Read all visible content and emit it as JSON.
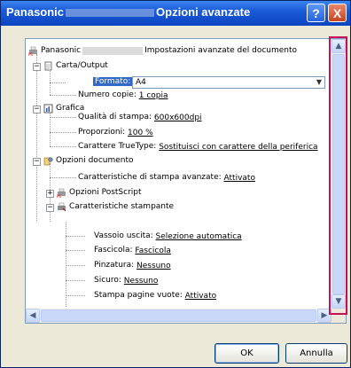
{
  "window": {
    "title_prefix": "Panasonic",
    "title_suffix": "Opzioni avanzate",
    "help_label": "?",
    "close_label": "X"
  },
  "tree": {
    "root_prefix": "Panasonic",
    "root_suffix": "Impostazioni avanzate del documento",
    "carta_output": "Carta/Output",
    "formato_label": "Formato:",
    "formato_value": "A4",
    "numero_copie_label": "Numero copie:",
    "numero_copie_value": "1 copia",
    "grafica": "Grafica",
    "qualita_label": "Qualità di stampa:",
    "qualita_value": "600x600dpi",
    "proporzioni_label": "Proporzioni:",
    "proporzioni_value": "100 %",
    "truetype_label": "Carattere TrueType:",
    "truetype_value": "Sostituisci con carattere della periferica",
    "opzioni_documento": "Opzioni documento",
    "caratteristiche_avanzate_label": "Caratteristiche di stampa avanzate:",
    "caratteristiche_avanzate_value": "Attivato",
    "opzioni_postscript": "Opzioni PostScript",
    "caratteristiche_stampante": "Caratteristiche stampante",
    "vassoio_label": "Vassoio uscita:",
    "vassoio_value": "Selezione automatica",
    "fascicola_label": "Fascicola:",
    "fascicola_value": "Fascicola",
    "pinzatura_label": "Pinzatura:",
    "pinzatura_value": "Nessuno",
    "sicuro_label": "Sicuro:",
    "sicuro_value": "Nessuno",
    "stampa_vuote_label": "Stampa pagine vuote:",
    "stampa_vuote_value": "Attivato"
  },
  "buttons": {
    "ok": "OK",
    "cancel": "Annulla"
  },
  "colors": {
    "highlight": "#c8105a",
    "titlebar": "#1a5ad8"
  }
}
